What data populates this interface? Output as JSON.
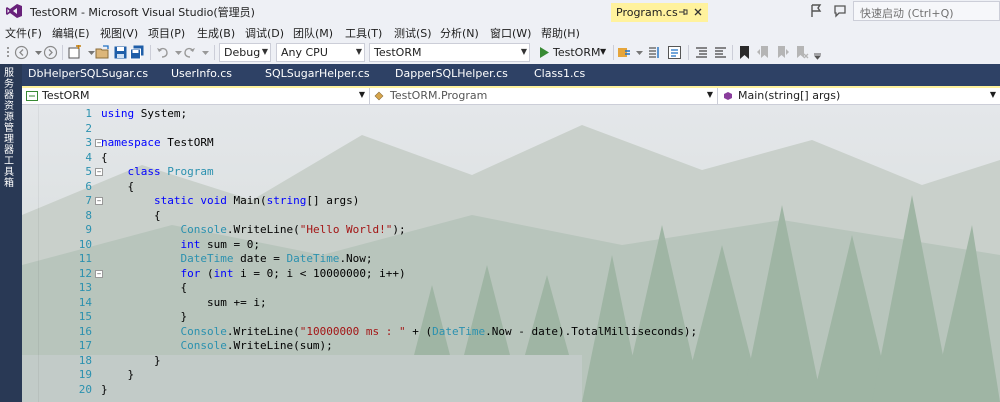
{
  "window": {
    "title": "TestORM - Microsoft Visual Studio(管理员)",
    "quick_launch_placeholder": "快速启动 (Ctrl+Q)"
  },
  "menu": [
    "文件(F)",
    "编辑(E)",
    "视图(V)",
    "项目(P)",
    "生成(B)",
    "调试(D)",
    "团队(M)",
    "工具(T)",
    "测试(S)",
    "分析(N)",
    "窗口(W)",
    "帮助(H)"
  ],
  "toolbar": {
    "config": "Debug",
    "platform": "Any CPU",
    "startup_project": "TestORM",
    "start_label": "TestORM"
  },
  "side_panel": {
    "server_explorer": "服务器资源管理器",
    "toolbox": "工具箱"
  },
  "tabs": [
    {
      "label": "DbHelperSQLSugar.cs"
    },
    {
      "label": "UserInfo.cs"
    },
    {
      "label": "SQLSugarHelper.cs"
    },
    {
      "label": "DapperSQLHelper.cs"
    },
    {
      "label": "Class1.cs"
    },
    {
      "label": "Program.cs",
      "active": true
    }
  ],
  "nav": {
    "project": "TestORM",
    "type": "TestORM.Program",
    "member": "Main(string[] args)"
  },
  "code_lines": [
    {
      "n": "1",
      "segments": [
        [
          "k",
          "using"
        ],
        [
          "p",
          " System;"
        ]
      ]
    },
    {
      "n": "2",
      "segments": []
    },
    {
      "n": "3",
      "segments": [
        [
          "k",
          "namespace"
        ],
        [
          "p",
          " TestORM"
        ]
      ],
      "fold": true
    },
    {
      "n": "4",
      "segments": [
        [
          "p",
          "{"
        ]
      ]
    },
    {
      "n": "5",
      "segments": [
        [
          "p",
          "    "
        ],
        [
          "k",
          "class"
        ],
        [
          "p",
          " "
        ],
        [
          "t",
          "Program"
        ]
      ],
      "fold": true
    },
    {
      "n": "6",
      "segments": [
        [
          "p",
          "    {"
        ]
      ]
    },
    {
      "n": "7",
      "segments": [
        [
          "p",
          "        "
        ],
        [
          "k",
          "static"
        ],
        [
          "p",
          " "
        ],
        [
          "k",
          "void"
        ],
        [
          "p",
          " Main("
        ],
        [
          "k",
          "string"
        ],
        [
          "p",
          "[] args)"
        ]
      ],
      "fold": true
    },
    {
      "n": "8",
      "segments": [
        [
          "p",
          "        {"
        ]
      ]
    },
    {
      "n": "9",
      "segments": [
        [
          "p",
          "            "
        ],
        [
          "t",
          "Console"
        ],
        [
          "p",
          ".WriteLine("
        ],
        [
          "s",
          "\"Hello World!\""
        ],
        [
          "p",
          ");"
        ]
      ]
    },
    {
      "n": "10",
      "segments": [
        [
          "p",
          "            "
        ],
        [
          "k",
          "int"
        ],
        [
          "p",
          " sum = 0;"
        ]
      ]
    },
    {
      "n": "11",
      "segments": [
        [
          "p",
          "            "
        ],
        [
          "t",
          "DateTime"
        ],
        [
          "p",
          " date = "
        ],
        [
          "t",
          "DateTime"
        ],
        [
          "p",
          ".Now;"
        ]
      ]
    },
    {
      "n": "12",
      "segments": [
        [
          "p",
          "            "
        ],
        [
          "k",
          "for"
        ],
        [
          "p",
          " ("
        ],
        [
          "k",
          "int"
        ],
        [
          "p",
          " i = 0; i < 10000000; i++)"
        ]
      ],
      "fold": true
    },
    {
      "n": "13",
      "segments": [
        [
          "p",
          "            {"
        ]
      ]
    },
    {
      "n": "14",
      "segments": [
        [
          "p",
          "                sum += i;"
        ]
      ]
    },
    {
      "n": "15",
      "segments": [
        [
          "p",
          "            }"
        ]
      ]
    },
    {
      "n": "16",
      "segments": [
        [
          "p",
          "            "
        ],
        [
          "t",
          "Console"
        ],
        [
          "p",
          ".WriteLine("
        ],
        [
          "s",
          "\"10000000 ms : \""
        ],
        [
          "p",
          " + ("
        ],
        [
          "t",
          "DateTime"
        ],
        [
          "p",
          ".Now - date).TotalMilliseconds);"
        ]
      ]
    },
    {
      "n": "17",
      "segments": [
        [
          "p",
          "            "
        ],
        [
          "t",
          "Console"
        ],
        [
          "p",
          ".WriteLine(sum);"
        ]
      ]
    },
    {
      "n": "18",
      "segments": [
        [
          "p",
          "        }"
        ]
      ]
    },
    {
      "n": "19",
      "segments": [
        [
          "p",
          "    }"
        ]
      ]
    },
    {
      "n": "20",
      "segments": [
        [
          "p",
          "}"
        ]
      ]
    }
  ],
  "colors": {
    "keyword": "#0000ff",
    "type": "#2b91af",
    "string": "#a31515",
    "tab_bar": "#2e4165",
    "active_tab": "#fff29d"
  }
}
